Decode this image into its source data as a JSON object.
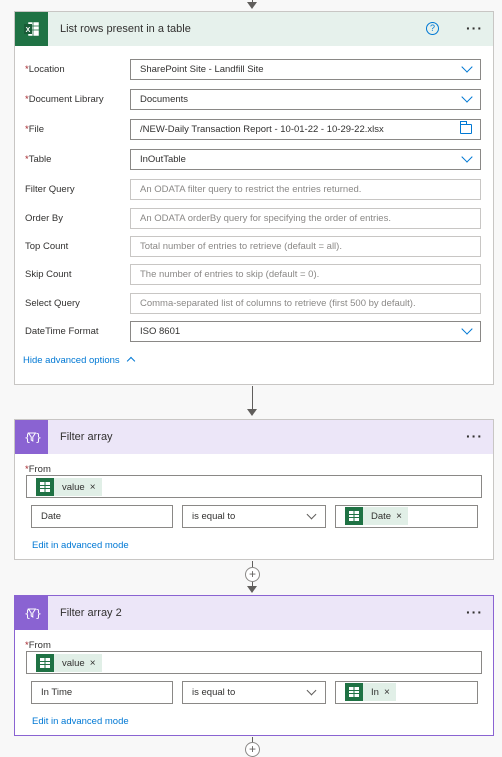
{
  "list_rows": {
    "title": "List rows present in a table",
    "help_glyph": "?",
    "more_glyph": "···",
    "fields": [
      {
        "label": "Location",
        "required": true,
        "value": "SharePoint Site - Landfill Site",
        "placeholder": "",
        "control": "dropdown"
      },
      {
        "label": "Document Library",
        "required": true,
        "value": "Documents",
        "placeholder": "",
        "control": "dropdown"
      },
      {
        "label": "File",
        "required": true,
        "value": "/NEW-Daily Transaction Report - 10-01-22 - 10-29-22.xlsx",
        "placeholder": "",
        "control": "file-picker"
      },
      {
        "label": "Table",
        "required": true,
        "value": "InOutTable",
        "placeholder": "",
        "control": "dropdown"
      },
      {
        "label": "Filter Query",
        "required": false,
        "value": "",
        "placeholder": "An ODATA filter query to restrict the entries returned.",
        "control": "text"
      },
      {
        "label": "Order By",
        "required": false,
        "value": "",
        "placeholder": "An ODATA orderBy query for specifying the order of entries.",
        "control": "text"
      },
      {
        "label": "Top Count",
        "required": false,
        "value": "",
        "placeholder": "Total number of entries to retrieve (default = all).",
        "control": "text"
      },
      {
        "label": "Skip Count",
        "required": false,
        "value": "",
        "placeholder": "The number of entries to skip (default = 0).",
        "control": "text"
      },
      {
        "label": "Select Query",
        "required": false,
        "value": "",
        "placeholder": "Comma-separated list of columns to retrieve (first 500 by default).",
        "control": "text"
      },
      {
        "label": "DateTime Format",
        "required": false,
        "value": "ISO 8601",
        "placeholder": "",
        "control": "dropdown"
      }
    ],
    "hide_advanced": "Hide advanced options"
  },
  "filter_array": {
    "title": "Filter array",
    "more_glyph": "···",
    "from_label": "From",
    "from_token": "value",
    "left_operand": "Date",
    "operator": "is equal to",
    "right_token": "Date",
    "edit_link": "Edit in advanced mode"
  },
  "filter_array_2": {
    "title": "Filter array 2",
    "more_glyph": "···",
    "from_label": "From",
    "from_token": "value",
    "left_operand": "In Time",
    "operator": "is equal to",
    "right_token": "In",
    "edit_link": "Edit in advanced mode"
  },
  "colors": {
    "excel_green": "#1f7244",
    "filter_purple": "#8a63d2",
    "link_blue": "#0078d4",
    "required_red": "#a4262c"
  },
  "glyphs": {
    "token_close": "×",
    "plus": "+",
    "required": "*"
  }
}
